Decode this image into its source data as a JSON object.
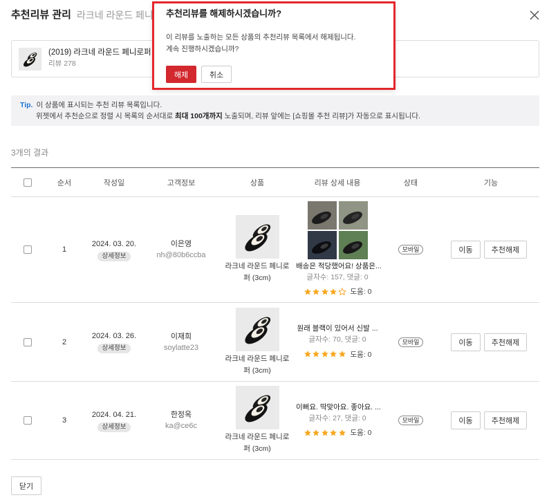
{
  "header": {
    "title": "추천리뷰 관리",
    "subtitle": "라크네 라운드 페니로",
    "close_icon": "close-icon"
  },
  "product_card": {
    "name": "(2019) 라크네 라운드 페니로퍼 (3cm",
    "review_count": "리뷰 278",
    "thumbnail_icon": "shoe-thumbnail"
  },
  "tip": {
    "label": "Tip.",
    "line1": "이 상품에 표시되는 추천 리뷰 목록입니다.",
    "line2_before": "위젯에서 추천순으로 정렬 시 목록의 순서대로 ",
    "line2_bold": "최대 100개까지",
    "line2_after": " 노출되며, 리뷰 앞에는 [쇼핑몰 추천 리뷰]가 자동으로 표시됩니다."
  },
  "result_count": "3개의 결과",
  "table": {
    "select_all_checked": false,
    "headers": {
      "order": "순서",
      "date": "작성일",
      "customer": "고객정보",
      "product": "상품",
      "review": "리뷰 상세 내용",
      "status": "상태",
      "actions": "기능"
    },
    "rows": [
      {
        "checked": false,
        "order": "1",
        "date": "2024. 03. 20.",
        "detail_label": "상세정보",
        "customer_name": "이은영",
        "customer_id": "nh@80b6ccba",
        "product_lines": [
          "라크네 라운드 페니로",
          "퍼 (3cm)"
        ],
        "review_photos": 4,
        "review_text": "배송은 적당했어요! 상품은...",
        "review_meta": "글자수: 157, 댓글: 0",
        "rating": 4,
        "helpful": "도움: 0",
        "status": "모바일",
        "move_label": "이동",
        "unrecommend_label": "추천해제"
      },
      {
        "checked": false,
        "order": "2",
        "date": "2024. 03. 26.",
        "detail_label": "상세정보",
        "customer_name": "이재희",
        "customer_id": "soylatte23",
        "product_lines": [
          "라크네 라운드 페니로",
          "퍼 (3cm)"
        ],
        "review_photos": 0,
        "review_text": "원래 블랙이 있어서 신발 ...",
        "review_meta": "글자수: 70, 댓글: 0",
        "rating": 5,
        "helpful": "도움: 0",
        "status": "모바일",
        "move_label": "이동",
        "unrecommend_label": "추천해제"
      },
      {
        "checked": false,
        "order": "3",
        "date": "2024. 04. 21.",
        "detail_label": "상세정보",
        "customer_name": "한정옥",
        "customer_id": "ka@ce6c",
        "product_lines": [
          "라크네 라운드 페니로",
          "퍼 (3cm)"
        ],
        "review_photos": 0,
        "review_text": "이뻐요. 딱맞아요. 좋아요. ...",
        "review_meta": "글자수: 27, 댓글: 0",
        "rating": 5,
        "helpful": "도움: 0",
        "status": "모바일",
        "move_label": "이동",
        "unrecommend_label": "추천해제"
      }
    ]
  },
  "footer": {
    "close_label": "닫기"
  },
  "dialog": {
    "title": "추천리뷰를 해제하시겠습니까?",
    "message_line1": "이 리뷰를 노출하는 모든 상품의 추천리뷰 목록에서 해제됩니다.",
    "message_line2": "계속 진행하시겠습니까?",
    "confirm_label": "해제",
    "cancel_label": "취소",
    "highlight_color": "#e3262b"
  },
  "colors": {
    "danger": "#d2282e",
    "tip_blue": "#1a74d2",
    "star": "#f6a821",
    "text": "#222222",
    "muted": "#888888"
  }
}
